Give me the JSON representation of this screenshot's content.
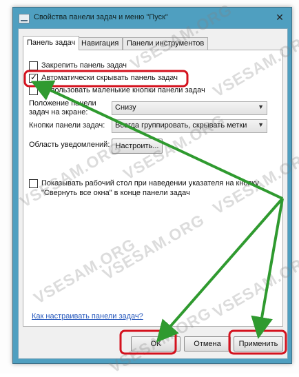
{
  "window": {
    "title": "Свойства панели задач и меню \"Пуск\"",
    "close_label": "✕",
    "icon": "taskbar-app-icon"
  },
  "tabs": [
    {
      "label": "Панель задач",
      "active": true
    },
    {
      "label": "Навигация",
      "active": false
    },
    {
      "label": "Панели инструментов",
      "active": false
    }
  ],
  "options": {
    "lock_taskbar": {
      "label": "Закрепить панель задач",
      "checked": false
    },
    "autohide": {
      "label": "Автоматически скрывать панель задач",
      "checked": true
    },
    "small_buttons": {
      "label": "Использовать маленькие кнопки панели задач",
      "checked": false
    }
  },
  "fields": {
    "location": {
      "label_line1": "Положение панели",
      "label_line2": "задач на экране:",
      "value": "Снизу"
    },
    "buttons": {
      "label": "Кнопки панели задач:",
      "value": "Всегда группировать, скрывать метки"
    },
    "notification": {
      "label": "Область уведомлений:",
      "button": "Настроить..."
    }
  },
  "peek": {
    "line1": "Показывать рабочий стол при наведении указателя на кнопку",
    "line2": "\"Свернуть все окна\" в конце панели задач",
    "checked": false
  },
  "link": "Как настраивать панели задач?",
  "buttons": {
    "ok": "ОК",
    "cancel": "Отмена",
    "apply": "Применить"
  },
  "watermark": "VSESAM.ORG",
  "annotation_color": "#d4121e",
  "arrow_color": "#2f9a2f"
}
